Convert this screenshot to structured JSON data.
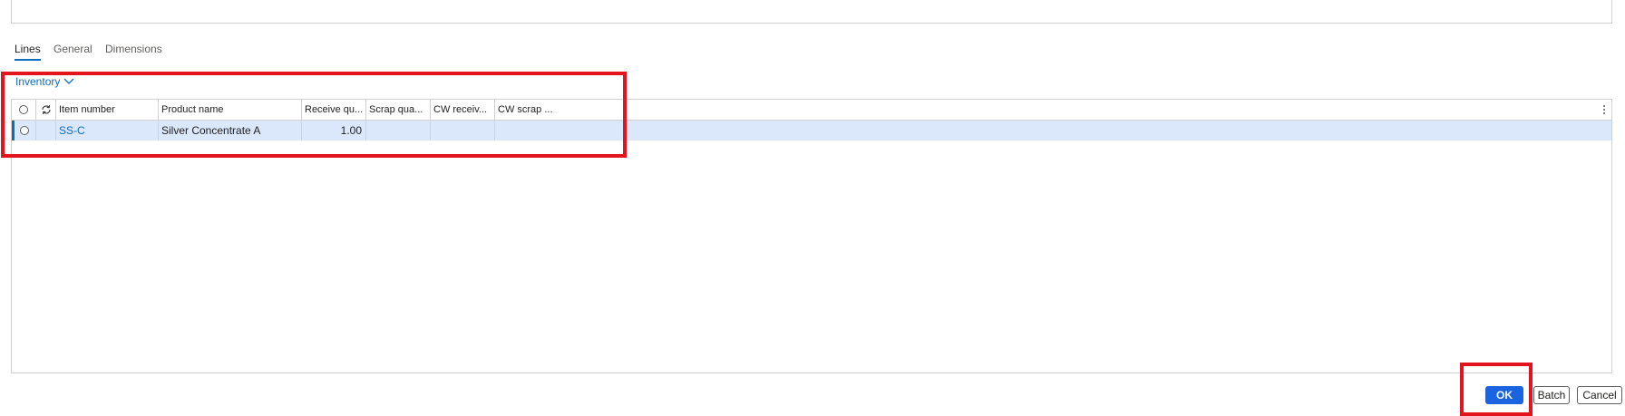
{
  "tabs": [
    {
      "label": "Lines",
      "active": true
    },
    {
      "label": "General",
      "active": false
    },
    {
      "label": "Dimensions",
      "active": false
    }
  ],
  "inventory_menu": {
    "label": "Inventory",
    "icon": "chevron-down-icon"
  },
  "grid": {
    "columns": [
      "Item number",
      "Product name",
      "Receive qu...",
      "Scrap qua...",
      "CW receiv...",
      "CW scrap ..."
    ],
    "rows": [
      {
        "item_number": "SS-C",
        "product_name": "Silver Concentrate A",
        "receive_qty": "1.00",
        "scrap_qty": "",
        "cw_receive": "",
        "cw_scrap": ""
      }
    ]
  },
  "buttons": {
    "ok": "OK",
    "batch": "Batch",
    "cancel": "Cancel"
  },
  "colors": {
    "accent": "#0f6cbd",
    "primary_button": "#1a64e0",
    "selected_row": "#dbe7fb",
    "annotation": "#e3141e"
  }
}
